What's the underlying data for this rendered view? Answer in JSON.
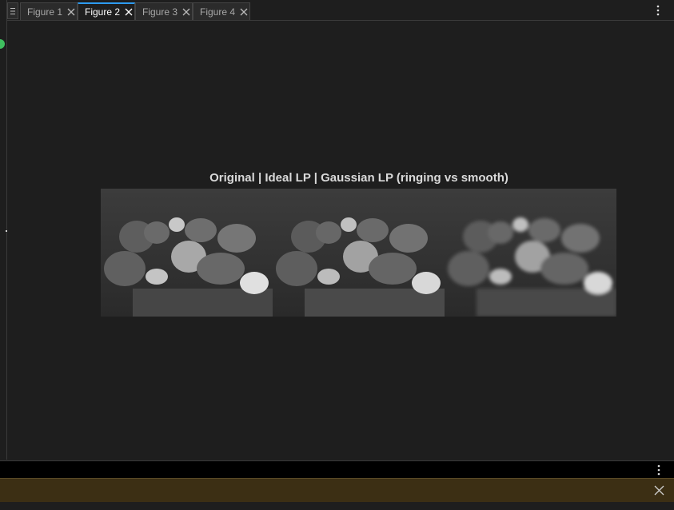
{
  "tabs": [
    {
      "label": "Figure 1",
      "active": false
    },
    {
      "label": "Figure 2",
      "active": true
    },
    {
      "label": "Figure 3",
      "active": false
    },
    {
      "label": "Figure 4",
      "active": false
    }
  ],
  "figure": {
    "title": "Original | Ideal LP | Gaussian LP (ringing vs smooth)",
    "panels": [
      "original-image",
      "ideal-lowpass-image",
      "gaussian-lowpass-image"
    ]
  },
  "icons": {
    "tab_menu": "hamburger-icon",
    "tab_close": "close-icon",
    "more": "vertical-ellipsis-icon",
    "notify_close": "close-icon",
    "status": "green-dot-icon"
  },
  "colors": {
    "background": "#1e1e1e",
    "active_tab_accent": "#2d9bf0",
    "notification_bar": "#3c2f14",
    "status_dot": "#3fbf5f"
  }
}
